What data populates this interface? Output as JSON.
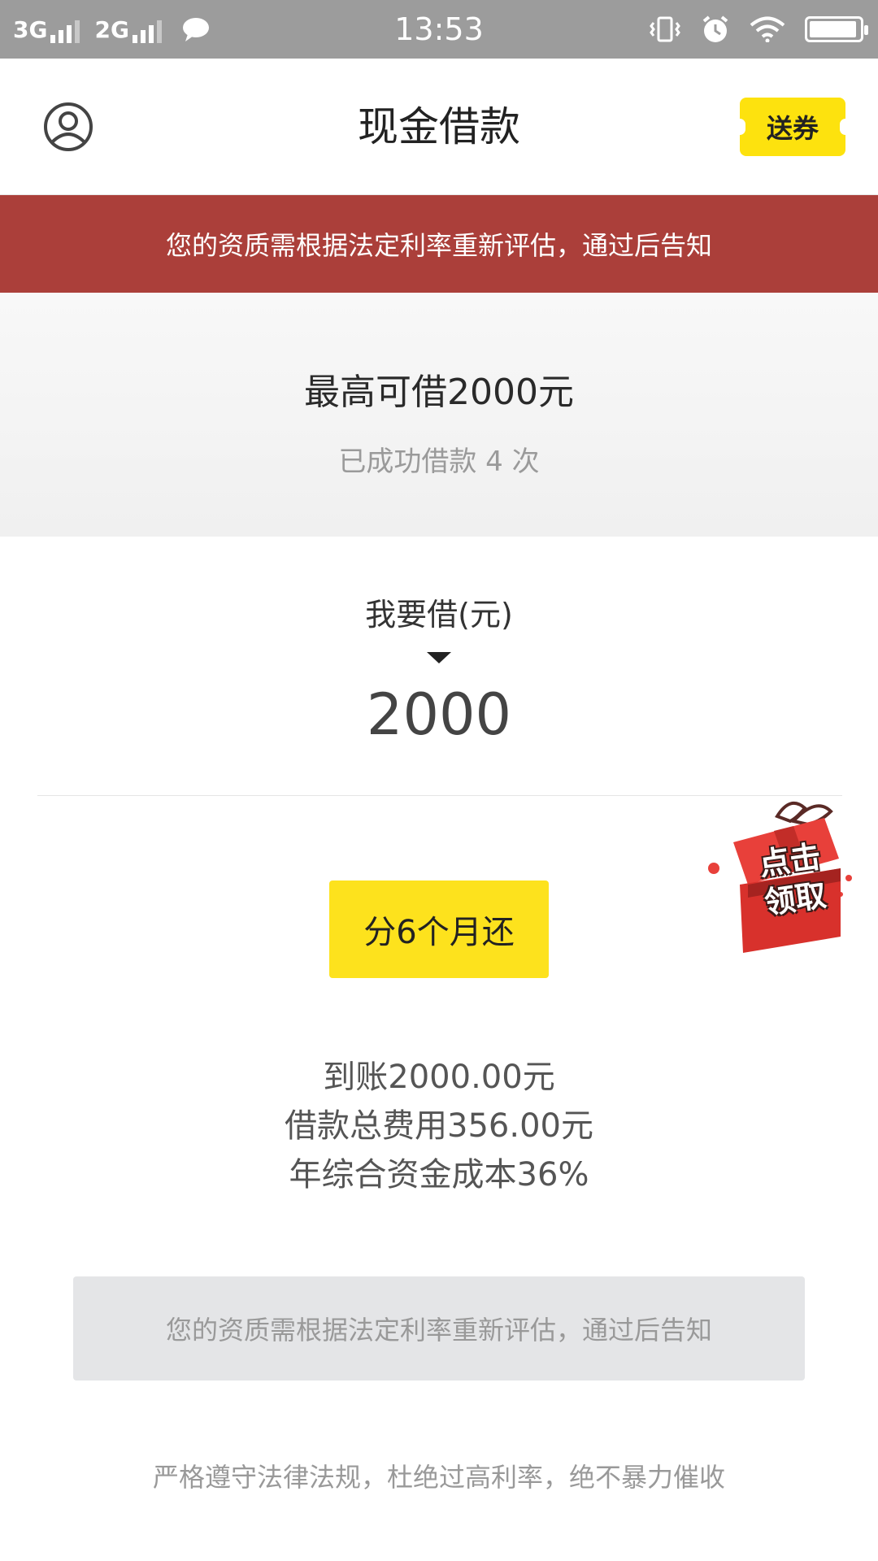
{
  "status_bar": {
    "network1": "3G",
    "network2": "2G",
    "time": "13:53",
    "battery_level": 0.95
  },
  "header": {
    "title": "现金借款",
    "coupon_label": "送券"
  },
  "banner": {
    "text": "您的资质需根据法定利率重新评估，通过后告知",
    "color": "#ab3f3a"
  },
  "quota": {
    "max_text": "最高可借2000元",
    "count_text": "已成功借款 4 次"
  },
  "amount": {
    "label": "我要借(元)",
    "value": "2000"
  },
  "gift": {
    "label_line1": "点击",
    "label_line2": "领取"
  },
  "term": {
    "label": "分6个月还",
    "color": "#fde21d"
  },
  "fees": {
    "received": "到账2000.00元",
    "total_fee": "借款总费用356.00元",
    "annual_cost": "年综合资金成本36%"
  },
  "submit": {
    "label": "您的资质需根据法定利率重新评估，通过后告知"
  },
  "footer": {
    "text": "严格遵守法律法规，杜绝过高利率，绝不暴力催收"
  }
}
